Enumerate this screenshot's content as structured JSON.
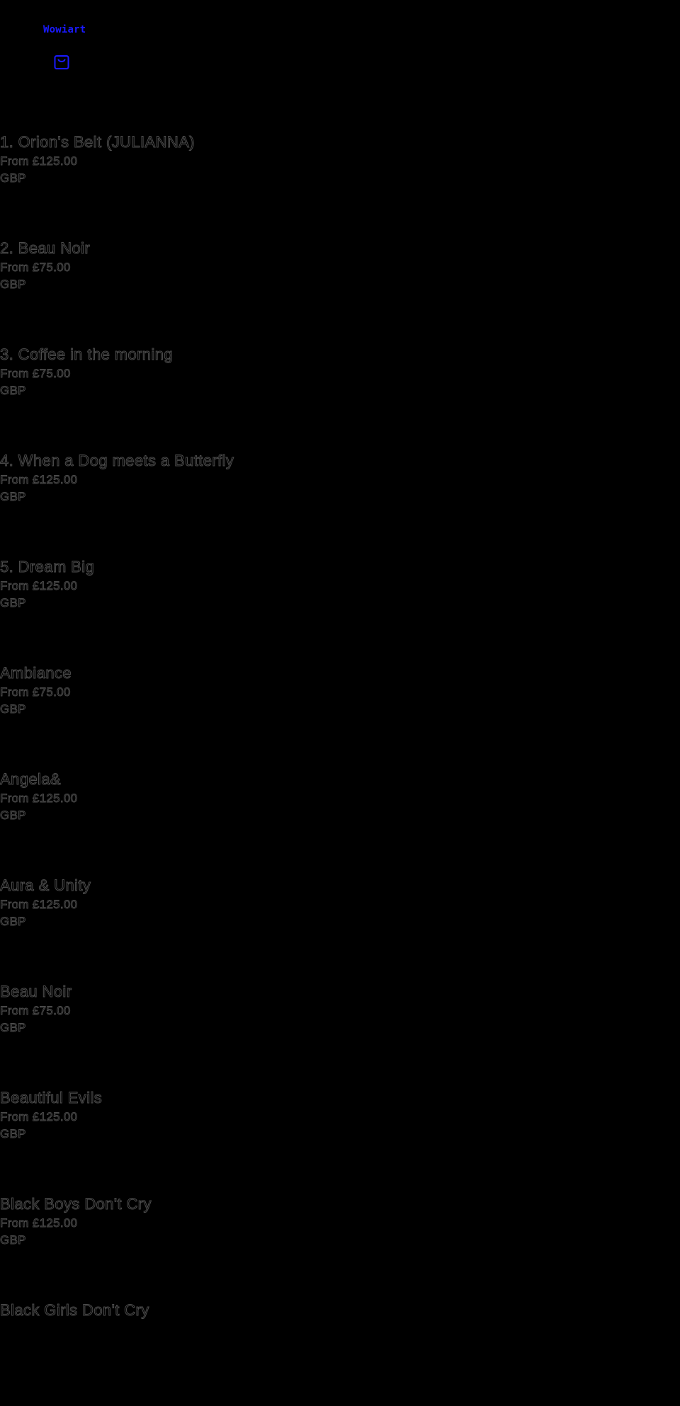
{
  "header": {
    "brand_label": "Wowiart",
    "cart_icon": "shopping-bag-icon",
    "accent_color": "#1a1aff"
  },
  "products": [
    {
      "title": "1. Orion's Belt (JULIANNA)",
      "price": "From £125.00",
      "currency": "GBP"
    },
    {
      "title": "2. Beau Noir",
      "price": "From £75.00",
      "currency": "GBP"
    },
    {
      "title": "3. Coffee in the morning",
      "price": "From £75.00",
      "currency": "GBP"
    },
    {
      "title": "4. When a Dog meets a Butterfly",
      "price": "From £125.00",
      "currency": "GBP"
    },
    {
      "title": "5. Dream Big",
      "price": "From £125.00",
      "currency": "GBP"
    },
    {
      "title": "Ambiance",
      "price": "From £75.00",
      "currency": "GBP"
    },
    {
      "title": "Angela&",
      "price": "From £125.00",
      "currency": "GBP"
    },
    {
      "title": "Aura & Unity",
      "price": "From £125.00",
      "currency": "GBP"
    },
    {
      "title": "Beau Noir",
      "price": "From £75.00",
      "currency": "GBP"
    },
    {
      "title": "Beautiful Evils",
      "price": "From £125.00",
      "currency": "GBP"
    },
    {
      "title": "Black Boys Don't Cry",
      "price": "From £125.00",
      "currency": "GBP"
    },
    {
      "title": "Black Girls Don't Cry",
      "price": "",
      "currency": ""
    }
  ]
}
